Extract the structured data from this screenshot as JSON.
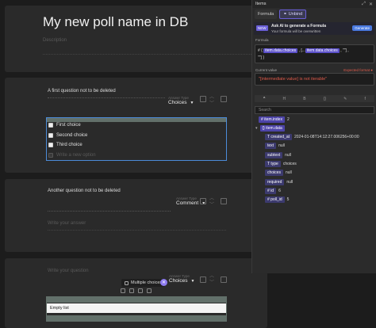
{
  "poll": {
    "title": "My new poll name in DB",
    "description_placeholder": "Description"
  },
  "questions": [
    {
      "label": "A first question not to be deleted",
      "answer_type_caption": "Answer Type",
      "answer_type": "Choices",
      "choices": [
        "First choice",
        "Second choice",
        "Third choice"
      ],
      "new_option_placeholder": "Write a new option"
    },
    {
      "label": "Another question not to be deleted",
      "answer_type_caption": "Answer Type",
      "answer_type": "Comment",
      "answer_placeholder": "Write your answer"
    },
    {
      "label_placeholder": "Write your question",
      "answer_type_caption": "Answer Type",
      "answer_type": "Choices",
      "chip_label": "Multiple choices",
      "empty_list_label": "Empty list"
    }
  ],
  "panel": {
    "title": "Items",
    "tabs": [
      {
        "label": "Formula",
        "icon": "function-icon"
      },
      {
        "label": "Unbind",
        "icon": "unlink-icon"
      }
    ],
    "ai_banner": {
      "badge": "NEW",
      "title": "Ask AI to generate a Formula",
      "subtitle": "Your formula will be overwritten",
      "button": "Generate"
    },
    "formula_caption": "Formula",
    "formula_parts": {
      "prefix": "# { ",
      "token1": "item.data.choices",
      "mid1": " , [...",
      "token2": "item.data.choices",
      "mid2": " , \"\"] ,",
      "line2": "\"\"] }"
    },
    "current_value_caption": "Current value",
    "expected_format": "Expected format",
    "current_value": "\"[intermediate value] is not iterable\"",
    "subtabs": [
      "^",
      "H",
      "B",
      "{}",
      "✎",
      "f"
    ],
    "search_placeholder": "Search",
    "tree": {
      "item_index": {
        "key": "item.index",
        "value": "2"
      },
      "item_data": {
        "key": "item.data"
      },
      "fields": [
        {
          "key": "created_at",
          "value": "2024-01-08T14:12:27.006256+00:00"
        },
        {
          "key": "text",
          "value": "null"
        },
        {
          "key": "subtext",
          "value": "null"
        },
        {
          "key": "type",
          "value": "choices"
        },
        {
          "key": "choices",
          "value": "null"
        },
        {
          "key": "required",
          "value": "null"
        },
        {
          "key": "id",
          "value": "6"
        },
        {
          "key": "poll_id",
          "value": "5"
        }
      ]
    }
  }
}
